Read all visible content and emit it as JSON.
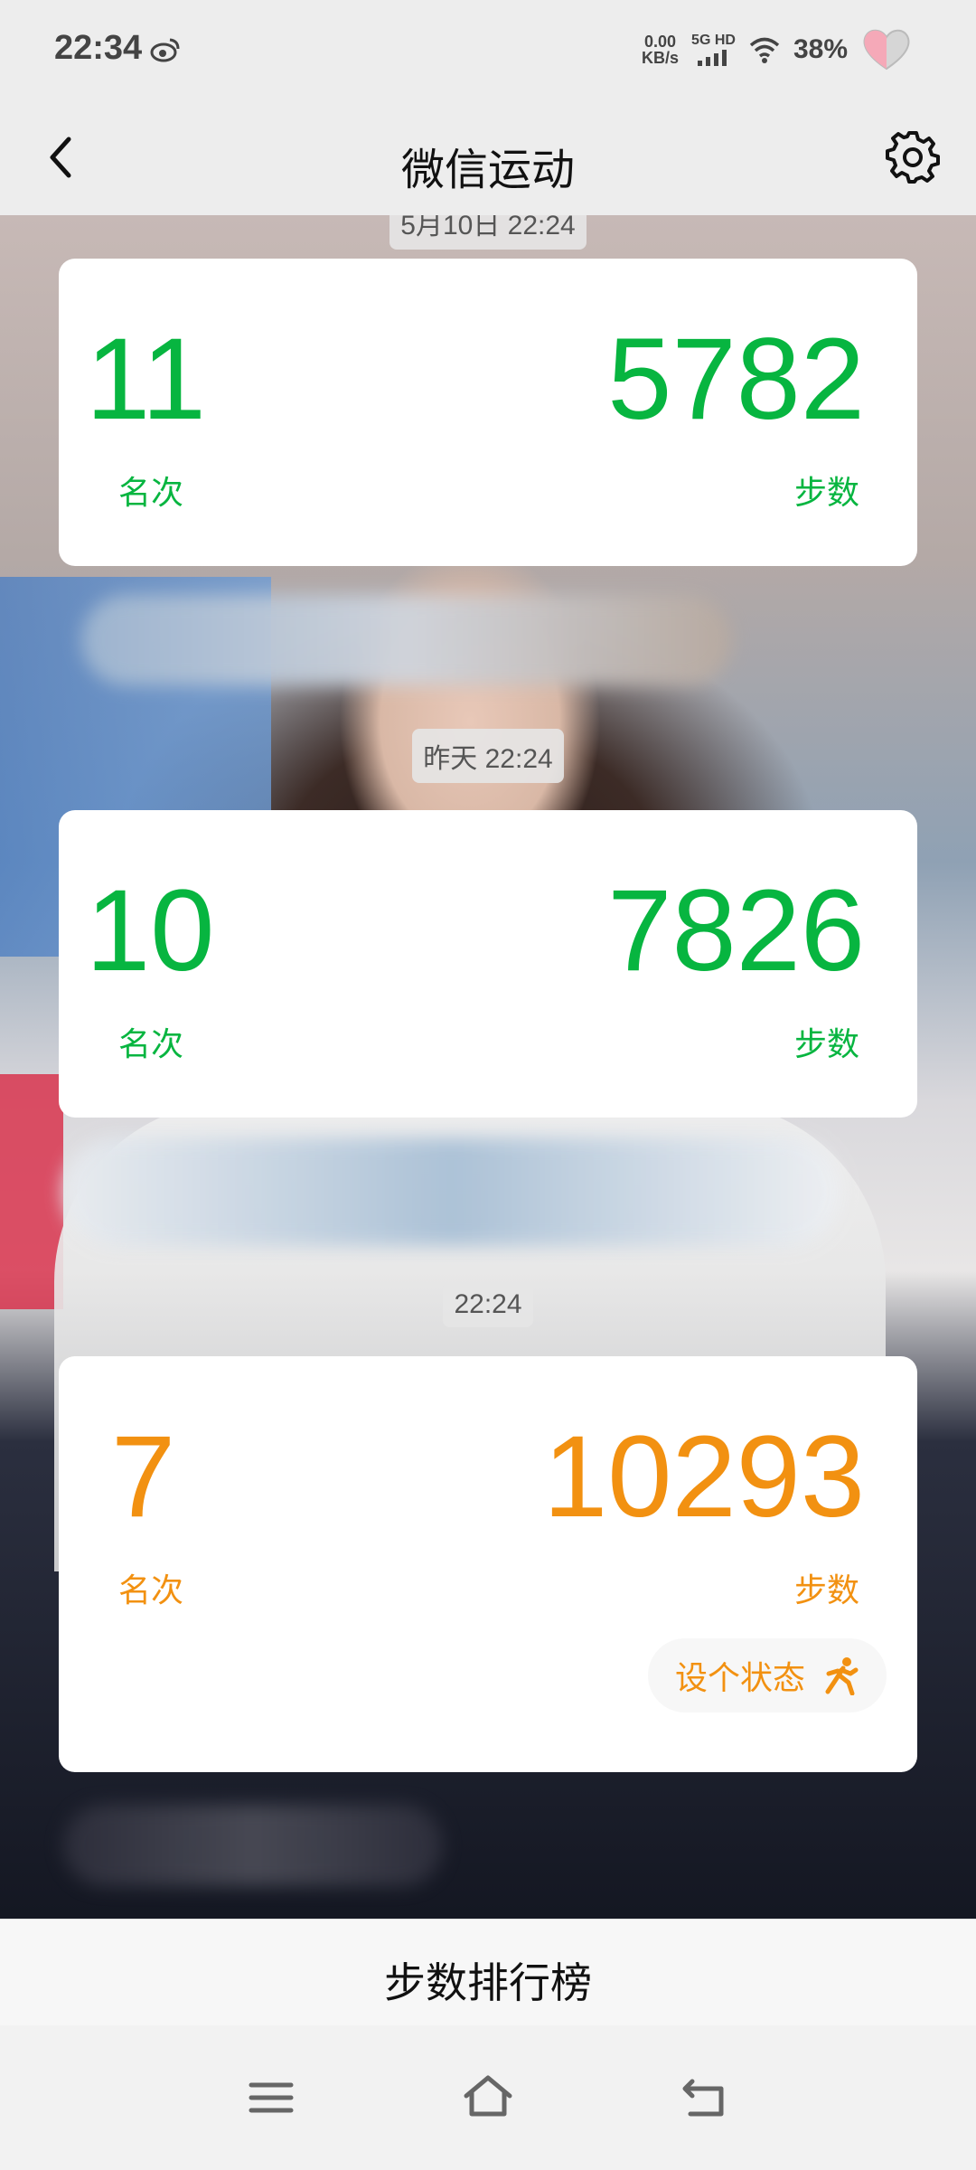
{
  "status_bar": {
    "time": "22:34",
    "net_speed_value": "0.00",
    "net_speed_unit": "KB/s",
    "signal_label": "5G HD",
    "battery": "38%"
  },
  "nav": {
    "title": "微信运动"
  },
  "timestamps": {
    "partial": "5月10日 22:24",
    "yesterday": "昨天 22:24",
    "today": "22:24"
  },
  "cards": [
    {
      "rank": "11",
      "steps": "5782",
      "rank_label": "名次",
      "steps_label": "步数",
      "color": "#07b540"
    },
    {
      "rank": "10",
      "steps": "7826",
      "rank_label": "名次",
      "steps_label": "步数",
      "color": "#07b540"
    },
    {
      "rank": "7",
      "steps": "10293",
      "rank_label": "名次",
      "steps_label": "步数",
      "color": "#f29111",
      "status_button": "设个状态"
    }
  ],
  "bottom_menu": {
    "label": "步数排行榜"
  },
  "icons": {
    "back": "chevron-left-icon",
    "settings": "gear-icon",
    "status": "running-person-icon",
    "menu": "menu-icon",
    "home": "home-icon",
    "return": "return-icon"
  }
}
